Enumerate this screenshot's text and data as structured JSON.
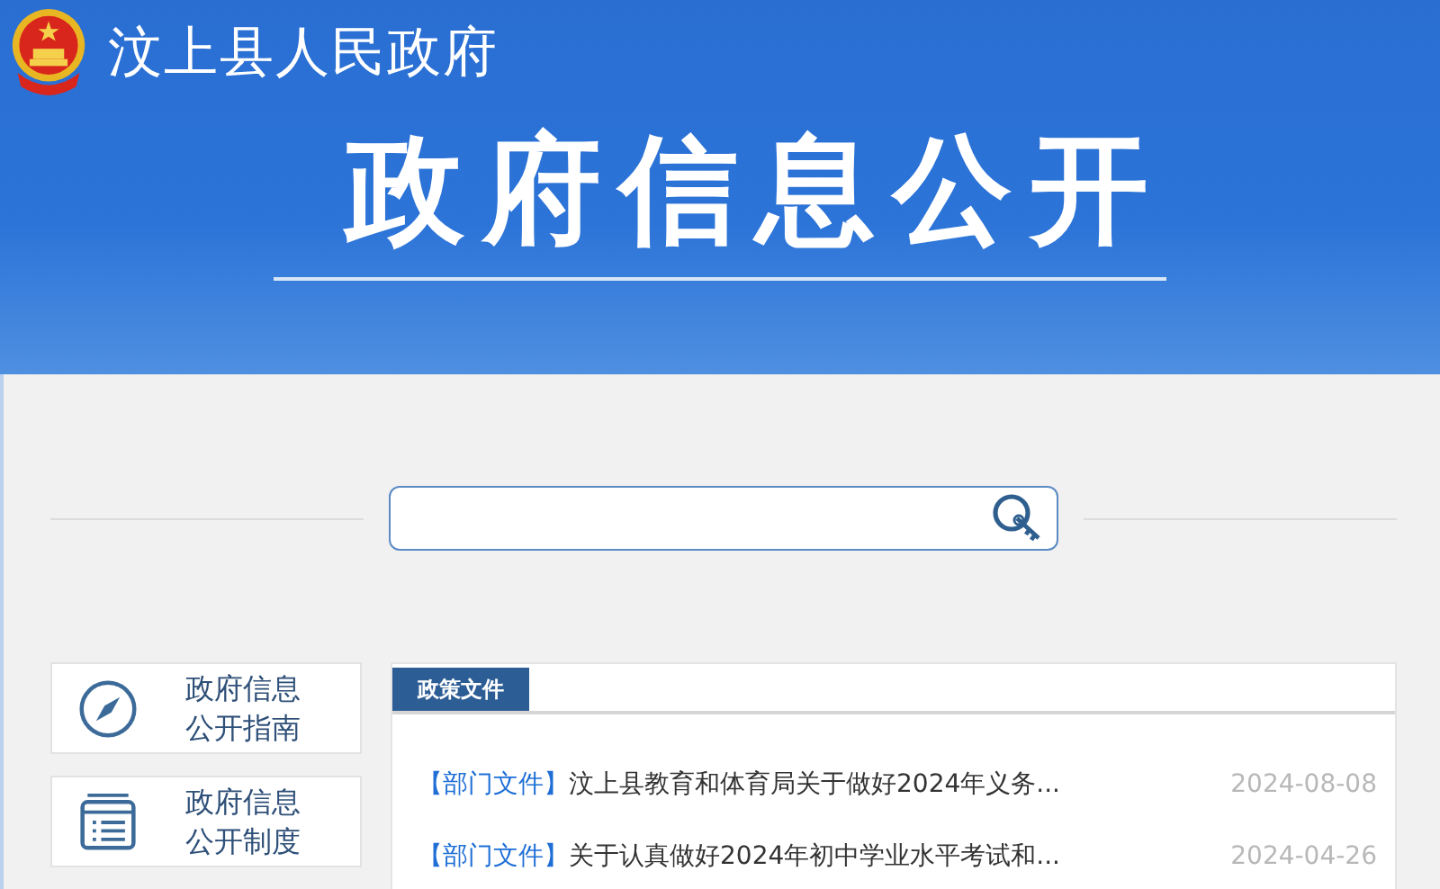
{
  "header": {
    "site_title": "汶上县人民政府",
    "banner_title": "政府信息公开"
  },
  "sidebar": {
    "items": [
      {
        "kind": "compass",
        "label": "政府信息公开指南"
      },
      {
        "kind": "list",
        "label": "政府信息公开制度"
      }
    ]
  },
  "panel": {
    "tabs": [
      {
        "label": "政策文件",
        "selected": true
      }
    ],
    "rows": [
      {
        "tag": "【部门文件】",
        "title": "汶上县教育和体育局关于做好2024年义务...",
        "date": "2024-08-08"
      },
      {
        "tag": "【部门文件】",
        "title": "关于认真做好2024年初中学业水平考试和...",
        "date": "2024-04-26"
      }
    ]
  }
}
